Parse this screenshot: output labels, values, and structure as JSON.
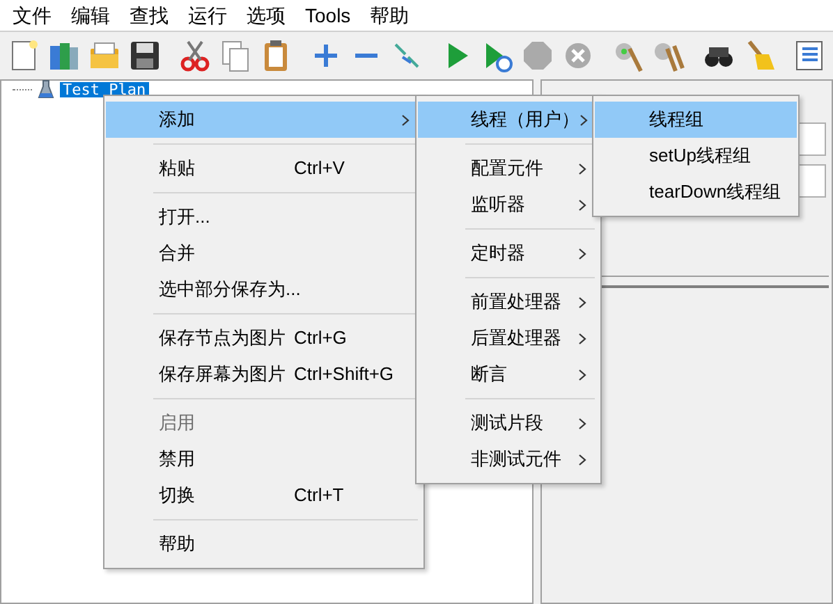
{
  "menubar": [
    {
      "label": "文件"
    },
    {
      "label": "编辑"
    },
    {
      "label": "查找"
    },
    {
      "label": "运行"
    },
    {
      "label": "选项"
    },
    {
      "label": "Tools"
    },
    {
      "label": "帮助"
    }
  ],
  "tree": {
    "items": [
      {
        "label": "Test Plan",
        "selected": true
      }
    ]
  },
  "context_menu": {
    "items": [
      {
        "kind": "item",
        "label": "添加",
        "submenu": true,
        "selected": true,
        "disabled": false
      },
      {
        "kind": "separator"
      },
      {
        "kind": "item",
        "label": "粘贴",
        "shortcut": "Ctrl+V",
        "submenu": false,
        "selected": false,
        "disabled": false
      },
      {
        "kind": "separator"
      },
      {
        "kind": "item",
        "label": "打开...",
        "submenu": false,
        "selected": false,
        "disabled": false
      },
      {
        "kind": "item",
        "label": "合并",
        "submenu": false,
        "selected": false,
        "disabled": false
      },
      {
        "kind": "item",
        "label": "选中部分保存为...",
        "submenu": false,
        "selected": false,
        "disabled": false
      },
      {
        "kind": "separator"
      },
      {
        "kind": "item",
        "label": "保存节点为图片",
        "shortcut": "Ctrl+G",
        "submenu": false,
        "selected": false,
        "disabled": false
      },
      {
        "kind": "item",
        "label": "保存屏幕为图片",
        "shortcut": "Ctrl+Shift+G",
        "submenu": false,
        "selected": false,
        "disabled": false
      },
      {
        "kind": "separator"
      },
      {
        "kind": "item",
        "label": "启用",
        "submenu": false,
        "selected": false,
        "disabled": true
      },
      {
        "kind": "item",
        "label": "禁用",
        "submenu": false,
        "selected": false,
        "disabled": false
      },
      {
        "kind": "item",
        "label": "切换",
        "shortcut": "Ctrl+T",
        "submenu": false,
        "selected": false,
        "disabled": false
      },
      {
        "kind": "separator"
      },
      {
        "kind": "item",
        "label": "帮助",
        "submenu": false,
        "selected": false,
        "disabled": false
      }
    ]
  },
  "add_submenu": {
    "items": [
      {
        "kind": "item",
        "label": "线程（用户）",
        "submenu": true,
        "selected": true
      },
      {
        "kind": "separator"
      },
      {
        "kind": "item",
        "label": "配置元件",
        "submenu": true,
        "selected": false
      },
      {
        "kind": "item",
        "label": "监听器",
        "submenu": true,
        "selected": false
      },
      {
        "kind": "separator"
      },
      {
        "kind": "item",
        "label": "定时器",
        "submenu": true,
        "selected": false
      },
      {
        "kind": "separator"
      },
      {
        "kind": "item",
        "label": "前置处理器",
        "submenu": true,
        "selected": false
      },
      {
        "kind": "item",
        "label": "后置处理器",
        "submenu": true,
        "selected": false
      },
      {
        "kind": "item",
        "label": "断言",
        "submenu": true,
        "selected": false
      },
      {
        "kind": "separator"
      },
      {
        "kind": "item",
        "label": "测试片段",
        "submenu": true,
        "selected": false
      },
      {
        "kind": "item",
        "label": "非测试元件",
        "submenu": true,
        "selected": false
      }
    ]
  },
  "threads_submenu": {
    "items": [
      {
        "kind": "item",
        "label": "线程组",
        "selected": true
      },
      {
        "kind": "item",
        "label": "setUp线程组",
        "selected": false
      },
      {
        "kind": "item",
        "label": "tearDown线程组",
        "selected": false
      }
    ]
  }
}
